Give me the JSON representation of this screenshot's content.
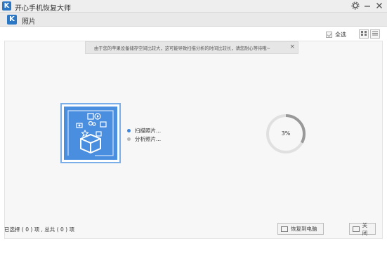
{
  "window": {
    "app_title": "开心手机恢复大师",
    "logo_letter": "K",
    "controls": [
      "settings-icon",
      "minimize-icon",
      "close-icon"
    ]
  },
  "subheader": {
    "logo_letter": "K",
    "title": "照片"
  },
  "toolbar": {
    "select_all_label": "全选",
    "view_modes": [
      "grid-view-icon",
      "list-view-icon"
    ]
  },
  "notice": {
    "text": "由于您的苹果设备储存空间比较大，这可能导致扫描分析的时间比较长，请您耐心等待哦~",
    "close_glyph": "×"
  },
  "scan": {
    "steps": [
      {
        "label": "扫描照片...",
        "state": "active"
      },
      {
        "label": "分析照片...",
        "state": "pending"
      }
    ],
    "progress_percent": 3,
    "progress_label": "3%"
  },
  "status": {
    "selection_text": "已选择 ( 0 ) 项 , 总共 ( 0 ) 项",
    "recover_button": "恢复到电脑",
    "close_button": "关闭"
  },
  "colors": {
    "accent": "#2a78c5",
    "illustration_bg": "#4a8ee0",
    "progress_track": "#d8d8d8",
    "progress_fill": "#999999"
  }
}
